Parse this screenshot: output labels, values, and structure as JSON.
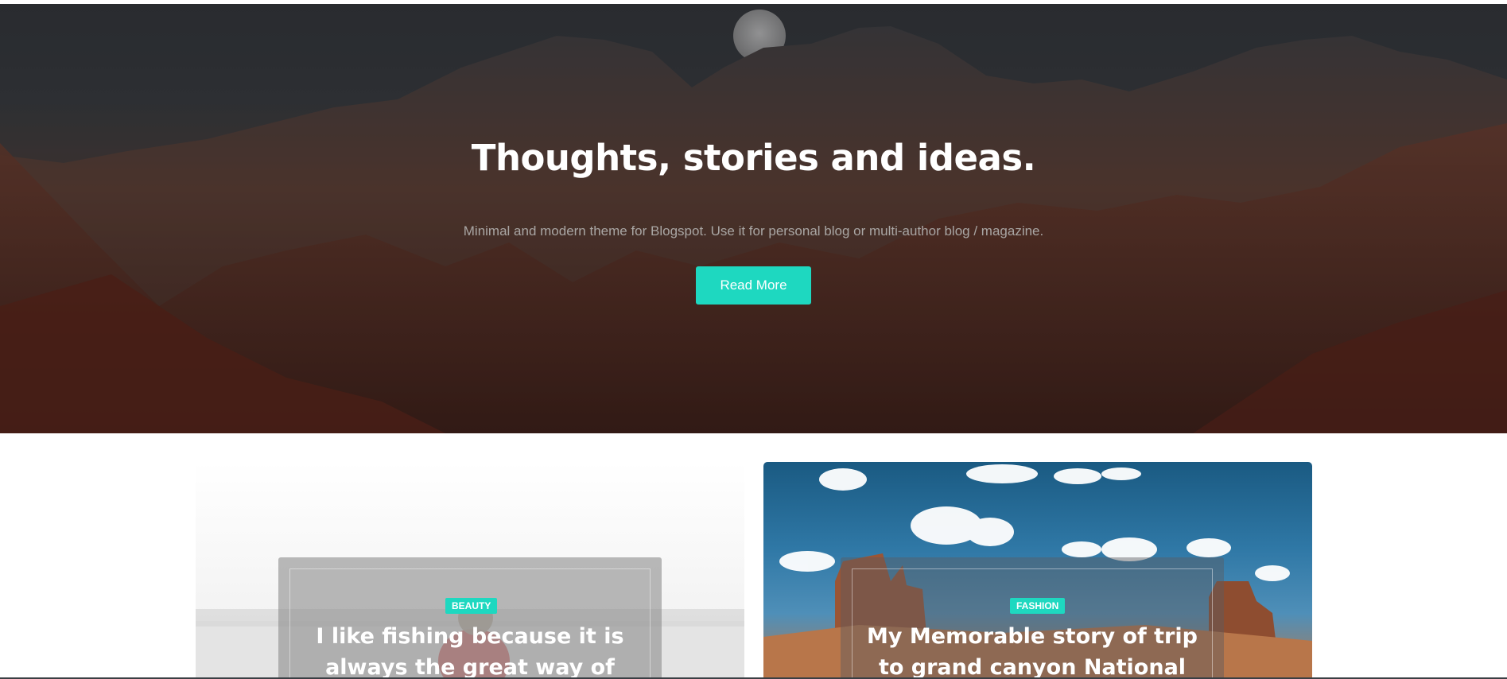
{
  "hero": {
    "title": "Thoughts, stories and ideas.",
    "subtitle": "Minimal and modern theme for Blogspot. Use it for personal blog or multi-author blog / magazine.",
    "button_label": "Read More",
    "accent_color": "#1ed8c0"
  },
  "posts": [
    {
      "category": "BEAUTY",
      "title_line1": "I like fishing because it is",
      "title_line2": "always the great way of"
    },
    {
      "category": "FASHION",
      "title_line1": "My Memorable story of trip",
      "title_line2": "to grand canyon National"
    }
  ]
}
